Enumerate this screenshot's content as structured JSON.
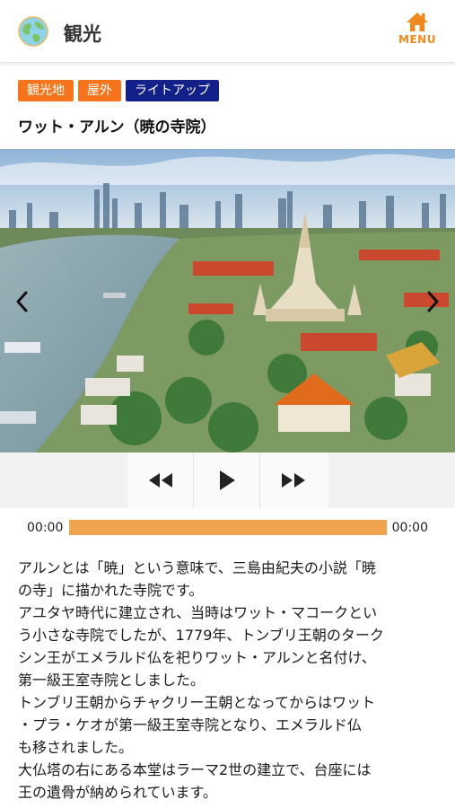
{
  "header": {
    "title": "観光",
    "menu_label": "MENU"
  },
  "tags": [
    {
      "label": "観光地",
      "color": "#f5741c"
    },
    {
      "label": "屋外",
      "color": "#f5741c"
    },
    {
      "label": "ライトアップ",
      "color": "#14208a"
    }
  ],
  "spot": {
    "title": "ワット・アルン（暁の寺院）"
  },
  "player": {
    "current_time": "00:00",
    "total_time": "00:00",
    "progress": 0
  },
  "description": {
    "lines": [
      "アルンとは「暁」という意味で、三島由紀夫の小説「暁",
      "の寺」に描かれた寺院です。",
      "アユタヤ時代に建立され、当時はワット・マコークとい",
      "う小さな寺院でしたが、1779年、トンブリ王朝のターク",
      "シン王がエメラルド仏を祀りワット・アルンと名付け、",
      "第一級王室寺院としました。",
      "トンブリ王朝からチャクリー王朝となってからはワット",
      "・プラ・ケオが第一級王室寺院となり、エメラルド仏",
      "も移されました。",
      "大仏塔の右にある本堂はラーマ2世の建立で、台座には",
      "王の遺骨が納められています。"
    ]
  },
  "colors": {
    "accent": "#f08a1c",
    "progress_bar": "#f0a44e"
  }
}
